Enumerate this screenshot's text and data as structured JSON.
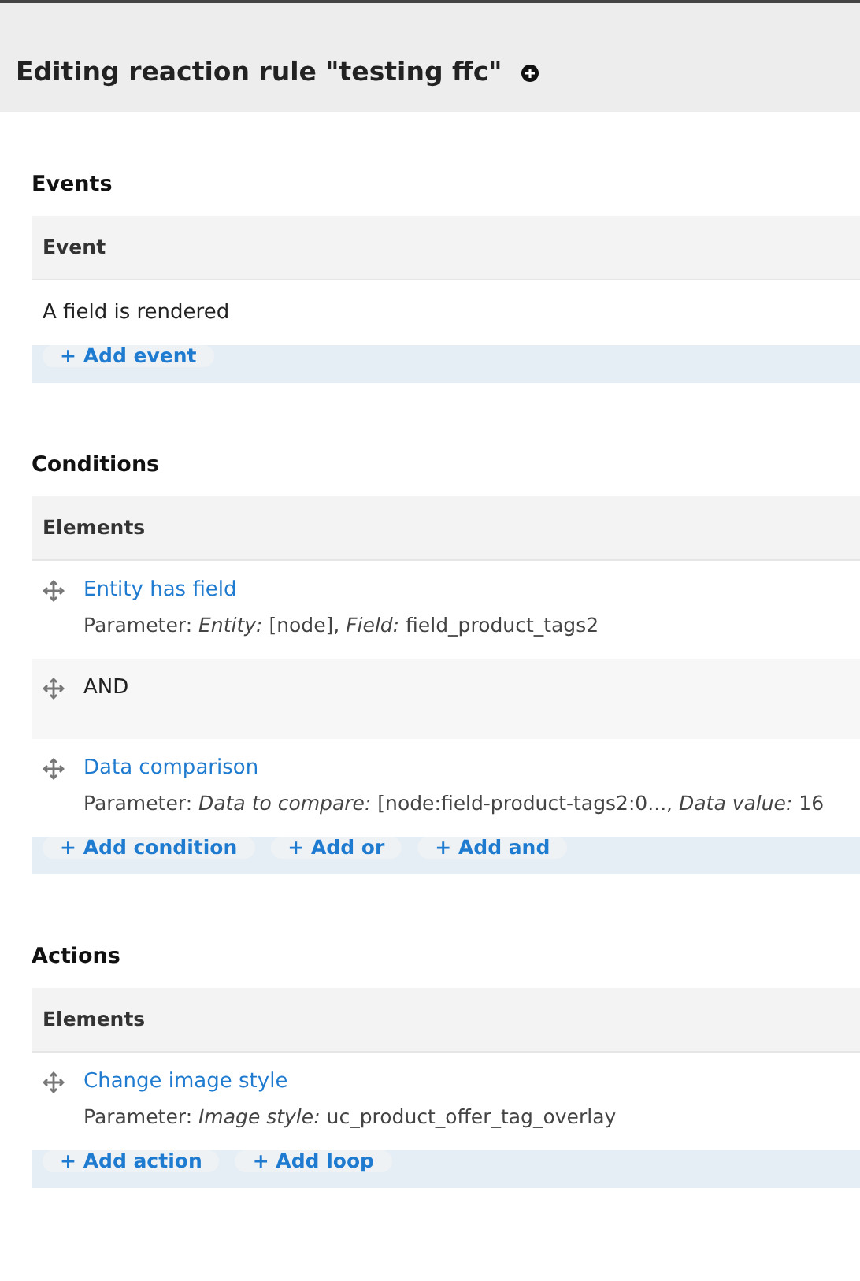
{
  "page_title": "Editing reaction rule \"testing ffc\"",
  "sections": [
    {
      "heading": "Events",
      "column": "Event",
      "rows": [
        {
          "kind": "text",
          "label": "A field is rendered"
        }
      ],
      "buttons": [
        "+ Add event"
      ]
    },
    {
      "heading": "Conditions",
      "column": "Elements",
      "rows": [
        {
          "kind": "element",
          "label": "Entity has field",
          "parameter": "Parameter: *Entity:* [node], *Field:* field_product_tags2"
        },
        {
          "kind": "operator",
          "label": "AND"
        },
        {
          "kind": "element",
          "label": "Data comparison",
          "parameter": "Parameter: *Data to compare:* [node:field-product-tags2:0..., *Data value:* 16"
        }
      ],
      "buttons": [
        "+ Add condition",
        "+ Add or",
        "+ Add and"
      ]
    },
    {
      "heading": "Actions",
      "column": "Elements",
      "rows": [
        {
          "kind": "element",
          "label": "Change image style",
          "parameter": "Parameter: *Image style:* uc_product_offer_tag_overlay"
        }
      ],
      "buttons": [
        "+ Add action",
        "+ Add loop"
      ]
    }
  ]
}
